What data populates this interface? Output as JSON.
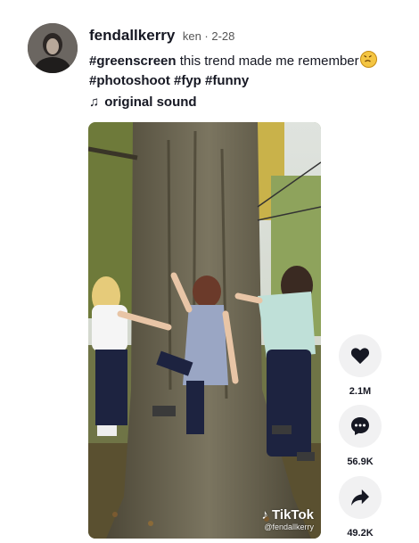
{
  "post": {
    "username": "fendallkerry",
    "nickname_date": "ken · 2-28",
    "caption_tag1": "#greenscreen",
    "caption_text": " this trend made me remember",
    "caption_tag2": "#photoshoot",
    "caption_tag3": "#fyp",
    "caption_tag4": "#funny",
    "sound": "original sound"
  },
  "icons": {
    "music": "music-note-icon",
    "emoji": "angry-face-icon",
    "like": "heart-icon",
    "comment": "comment-icon",
    "share": "share-icon"
  },
  "watermark": {
    "logo": "TikTok",
    "user": "@fendallkerry"
  },
  "actions": {
    "likes": "2.1M",
    "comments": "56.9K",
    "shares": "49.2K"
  },
  "colors": {
    "text": "#161823",
    "button_bg": "#f1f1f2"
  }
}
